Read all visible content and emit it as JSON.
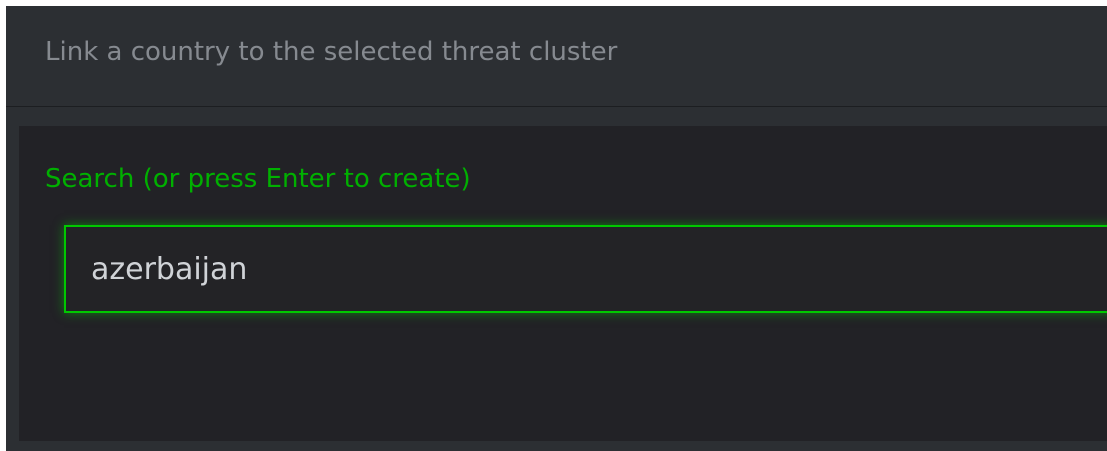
{
  "dialog": {
    "title": "Link a country to the selected threat cluster"
  },
  "search": {
    "label": "Search (or press Enter to create)",
    "value": "azerbaijan",
    "placeholder": ""
  },
  "colors": {
    "accent": "#00c800",
    "label": "#00b000",
    "header_bg": "#2c2f33",
    "panel_bg": "#222226"
  }
}
